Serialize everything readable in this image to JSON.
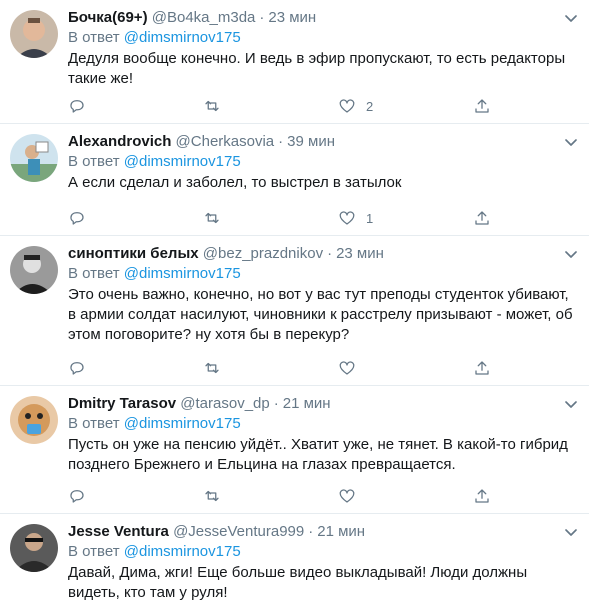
{
  "icons": {
    "reply": "reply-icon",
    "retweet": "retweet-icon",
    "like": "heart-icon",
    "share": "share-icon",
    "more": "chevron-down-icon"
  },
  "colors": {
    "mention": "#1b95e0",
    "secondary_text": "#657786",
    "divider": "#e6ecf0"
  },
  "tweets": [
    {
      "name": "Бочка(69+)",
      "handle": "@Bo4ka_m3da",
      "dot": "·",
      "time": "23 мин",
      "reply_prefix": "В ответ",
      "reply_to": "@dimsmirnov175",
      "text": "Дедуля вообще конечно. И ведь в эфир пропускают, то есть редакторы такие же!",
      "like_count": "2"
    },
    {
      "name": "Alexandrovich",
      "handle": "@Cherkasovia",
      "dot": "·",
      "time": "39 мин",
      "reply_prefix": "В ответ",
      "reply_to": "@dimsmirnov175",
      "text": "А если сделал и заболел, то выстрел в затылок",
      "like_count": "1"
    },
    {
      "name": "синоптики белых",
      "handle": "@bez_prazdnikov",
      "dot": "·",
      "time": "23 мин",
      "reply_prefix": "В ответ",
      "reply_to": "@dimsmirnov175",
      "text": "Это очень важно, конечно, но вот у вас тут преподы студенток убивают, в армии солдат насилуют, чиновники к расстрелу призывают - может, об этом поговорите? ну хотя бы в перекур?",
      "like_count": ""
    },
    {
      "name": "Dmitry Tarasov",
      "handle": "@tarasov_dp",
      "dot": "·",
      "time": "21 мин",
      "reply_prefix": "В ответ",
      "reply_to": "@dimsmirnov175",
      "text": "Пусть он уже на пенсию уйдёт.. Хватит уже, не тянет. В какой-то гибрид позднего Брежнего и Ельцина на глазах превращается.",
      "like_count": ""
    },
    {
      "name": "Jesse Ventura",
      "handle": "@JesseVentura999",
      "dot": "·",
      "time": "21 мин",
      "reply_prefix": "В ответ",
      "reply_to": "@dimsmirnov175",
      "text": "Давай, Дима, жги! Еще больше видео выкладывай! Люди должны видеть, кто там у руля!",
      "like_count": ""
    }
  ]
}
